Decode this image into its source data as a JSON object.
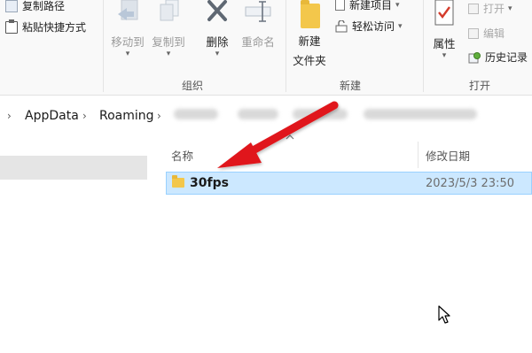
{
  "ribbon": {
    "clipboard": {
      "copy_path": "复制路径",
      "paste_shortcut": "粘贴快捷方式"
    },
    "organize": {
      "move_to": "移动到",
      "copy_to": "复制到",
      "delete": "删除",
      "rename": "重命名",
      "group_label": "组织"
    },
    "new": {
      "new_folder_line1": "新建",
      "new_folder_line2": "文件夹",
      "new_item": "新建项目",
      "easy_access": "轻松访问",
      "group_label": "新建"
    },
    "open": {
      "properties": "属性",
      "open": "打开",
      "edit": "编辑",
      "history": "历史记录",
      "group_label": "打开"
    }
  },
  "address": {
    "crumbs": [
      "AppData",
      "Roaming"
    ]
  },
  "columns": {
    "name": "名称",
    "date_modified": "修改日期"
  },
  "files": [
    {
      "name": "30fps",
      "date": "2023/5/3 23:50",
      "selected": true
    }
  ],
  "colors": {
    "selection_bg": "#cce8ff",
    "selection_border": "#99d1ff",
    "annotation_arrow": "#e0191b",
    "folder": "#f3c74b"
  }
}
